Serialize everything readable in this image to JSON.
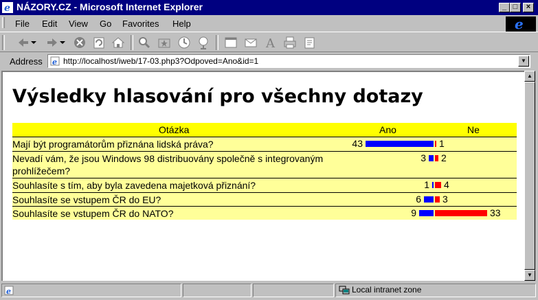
{
  "window": {
    "title": "NÁZORY.CZ - Microsoft Internet Explorer"
  },
  "menu": [
    "File",
    "Edit",
    "View",
    "Go",
    "Favorites",
    "Help"
  ],
  "address": {
    "label": "Address",
    "url": "http://localhost/iweb/17-03.php3?Odpoved=Ano&id=1"
  },
  "page": {
    "heading": "Výsledky hlasování pro všechny dotazy",
    "table": {
      "headers": {
        "question": "Otázka",
        "yes": "Ano",
        "no": "Ne"
      },
      "rows": [
        {
          "question": "Mají být programátorům přiznána lidská práva?",
          "yes": "43",
          "no": "1"
        },
        {
          "question": "Nevadí vám, že jsou Windows 98 distribuovány společně s integrovaným prohlížečem?",
          "yes": "3",
          "no": "2"
        },
        {
          "question": "Souhlasíte s tím, aby byla zavedena majetková přiznání?",
          "yes": "1",
          "no": "4"
        },
        {
          "question": "Souhlasíte se vstupem ČR do EU?",
          "yes": "6",
          "no": "3"
        },
        {
          "question": "Souhlasíte se vstupem ČR do NATO?",
          "yes": "9",
          "no": "33"
        }
      ]
    }
  },
  "status": {
    "zone": "Local intranet zone"
  },
  "colors": {
    "yes_bar": "#0000ff",
    "no_bar": "#ff0000",
    "header_bg": "#ffff00",
    "row_bg": "#ffff99",
    "titlebar": "#000080"
  }
}
